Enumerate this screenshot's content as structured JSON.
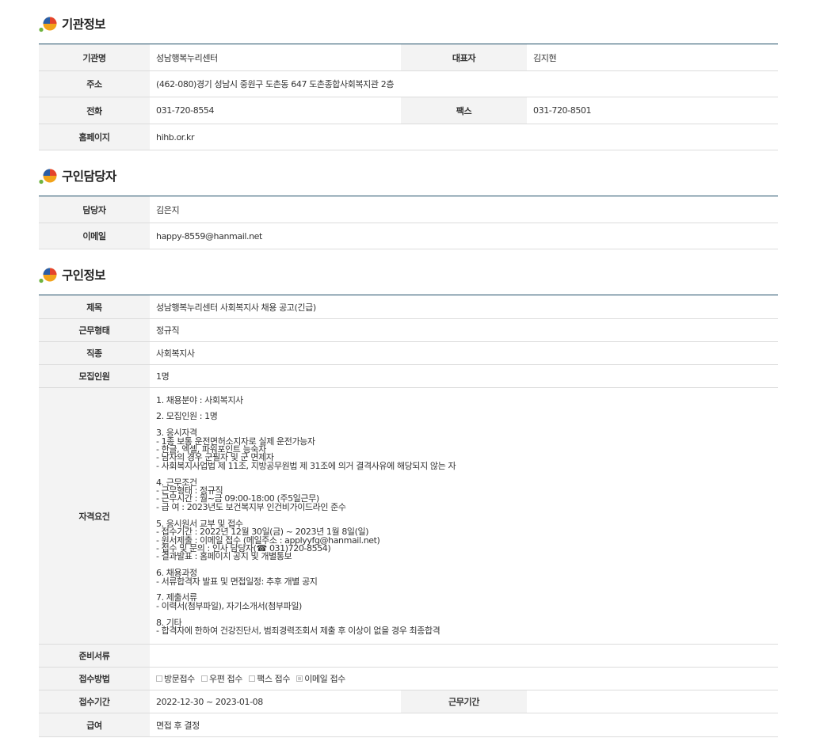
{
  "org": {
    "title": "기관정보",
    "name_label": "기관명",
    "name": "성남행복누리센터",
    "rep_label": "대표자",
    "rep": "김지현",
    "addr_label": "주소",
    "addr": "(462-080)경기 성남시 중원구 도촌동 647 도촌종합사회복지관 2층",
    "tel_label": "전화",
    "tel": "031-720-8554",
    "fax_label": "팩스",
    "fax": "031-720-8501",
    "home_label": "홈페이지",
    "home": "hihb.or.kr"
  },
  "contact": {
    "title": "구인담당자",
    "person_label": "담당자",
    "person": "김은지",
    "email_label": "이메일",
    "email": "happy-8559@hanmail.net"
  },
  "job": {
    "title": "구인정보",
    "subject_label": "제목",
    "subject": "성남행복누리센터 사회복지사 채용 공고(긴급)",
    "type_label": "근무형태",
    "type": "정규직",
    "kind_label": "직종",
    "kind": "사회복지사",
    "count_label": "모집인원",
    "count": "1명",
    "qual_label": "자격요건",
    "qual": "1. 채용분야 : 사회복지사\n\n2. 모집인원 : 1명\n\n3. 응시자격\n- 1종 보통 운전면허소지자로 실제 운전가능자\n- 한글, 엑셀, 파워포인트 능숙자\n- 남자의 경우 군필자 및 군 면제자\n- 사회복지사업법 제 11조, 지방공무원법 제 31조에 의거 결격사유에 해당되지 않는 자\n\n4. 근무조건\n- 근무형태 : 정규직\n- 근무시간 : 월~금 09:00-18:00 (주5일근무)\n- 급 여 : 2023년도 보건복지부 인건비가이드라인 준수\n\n5. 응시원서 교부 및 접수\n- 접수기간 : 2022년 12월 30일(금) ~ 2023년 1월 8일(일)\n- 원서제출 : 이메일 접수 (메일주소 : applyyfg@hanmail.net)\n- 접수 및 문의 : 인사 담당자(☎ 031)720-8554)\n- 결과발표 : 홈페이지 공지 및 개별통보\n\n6. 채용과정\n- 서류합격자 발표 및 면접일정: 추후 개별 공지\n\n7. 제출서류\n- 이력서(첨부파일), 자기소개서(첨부파일)\n\n8. 기타\n- 합격자에 한하여 건강진단서, 범죄경력조회서 제출 후 이상이 없을 경우 최종합격",
    "docs_label": "준비서류",
    "docs": "",
    "method_label": "접수방법",
    "methods": [
      {
        "label": "방문접수",
        "checked": false
      },
      {
        "label": "우편 접수",
        "checked": false
      },
      {
        "label": "팩스 접수",
        "checked": false
      },
      {
        "label": "이메일 접수",
        "checked": true
      }
    ],
    "period_label": "접수기간",
    "period": "2022-12-30 ~ 2023-01-08",
    "workperiod_label": "근무기간",
    "workperiod": "",
    "salary_label": "급여",
    "salary": "면접 후 결정"
  }
}
